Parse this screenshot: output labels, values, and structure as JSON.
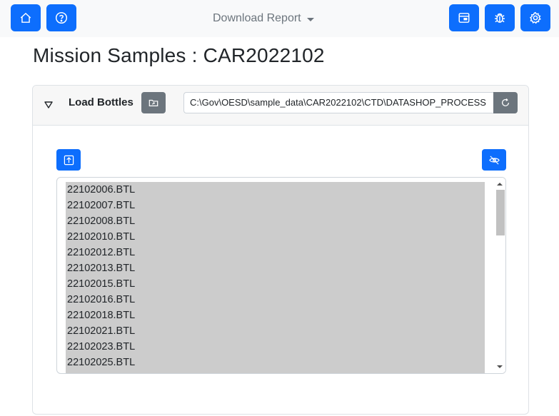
{
  "topbar": {
    "home_icon": "home-icon",
    "help_icon": "question-circle-icon",
    "report_dropdown": "Download Report",
    "window_icon": "window-icon",
    "bug_icon": "bug-icon",
    "settings_icon": "gear-icon"
  },
  "page": {
    "title": "Mission Samples : CAR2022102"
  },
  "card": {
    "header_label": "Load Bottles",
    "folder_icon": "folder-open-icon",
    "path_value": "C:\\Gov\\OESD\\sample_data\\CAR2022102\\CTD\\DATASHOP_PROCESS",
    "refresh_icon": "refresh-icon",
    "upload_icon": "upload-icon",
    "hide_icon": "eye-slash-icon"
  },
  "files": [
    "22102006.BTL",
    "22102007.BTL",
    "22102008.BTL",
    "22102010.BTL",
    "22102012.BTL",
    "22102013.BTL",
    "22102015.BTL",
    "22102016.BTL",
    "22102018.BTL",
    "22102021.BTL",
    "22102023.BTL",
    "22102025.BTL"
  ],
  "colors": {
    "primary": "#0d6efd",
    "secondary": "#6c757d",
    "selection": "#cccccc"
  }
}
